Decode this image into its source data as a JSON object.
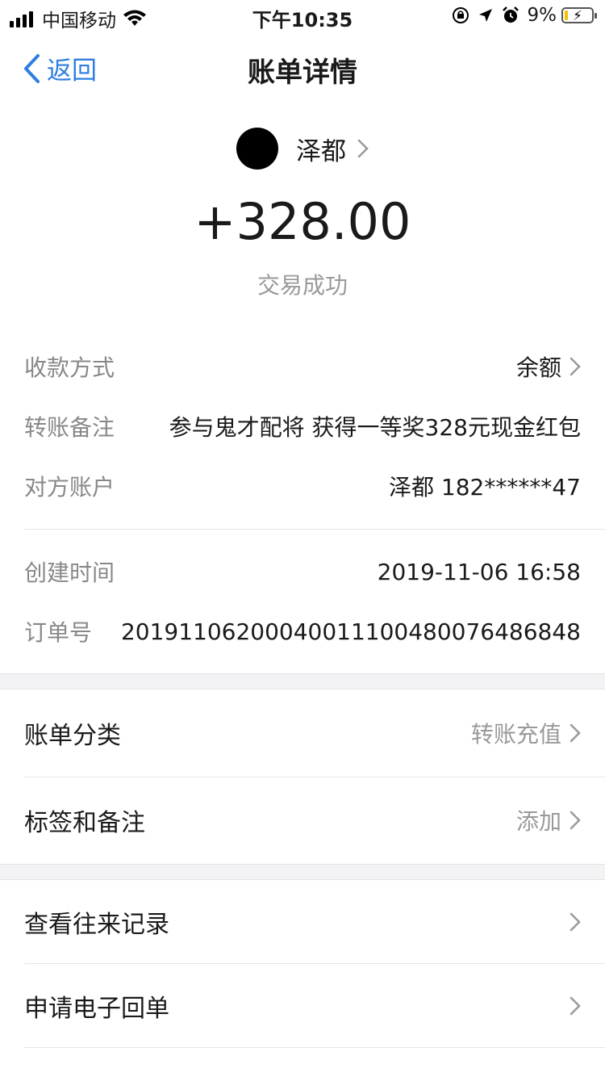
{
  "status_bar": {
    "carrier": "中国移动",
    "time": "下午10:35",
    "battery": "9%"
  },
  "nav": {
    "back_label": "返回",
    "title": "账单详情"
  },
  "payee": {
    "name": "泽都"
  },
  "amount": "+328.00",
  "status": "交易成功",
  "details": {
    "method_label": "收款方式",
    "method_value": "余额",
    "remark_label": "转账备注",
    "remark_value": "参与鬼才配将 获得一等奖328元现金红包",
    "account_label": "对方账户",
    "account_value": "泽都 182******47",
    "created_label": "创建时间",
    "created_value": "2019-11-06 16:58",
    "order_label": "订单号",
    "order_value": "20191106200040011100480076486848"
  },
  "menu": {
    "category_label": "账单分类",
    "category_value": "转账充值",
    "tags_label": "标签和备注",
    "tags_value": "添加",
    "history_label": "查看往来记录",
    "receipt_label": "申请电子回单"
  },
  "colors": {
    "accent": "#2f7de0",
    "muted": "#999999",
    "label": "#888888"
  }
}
